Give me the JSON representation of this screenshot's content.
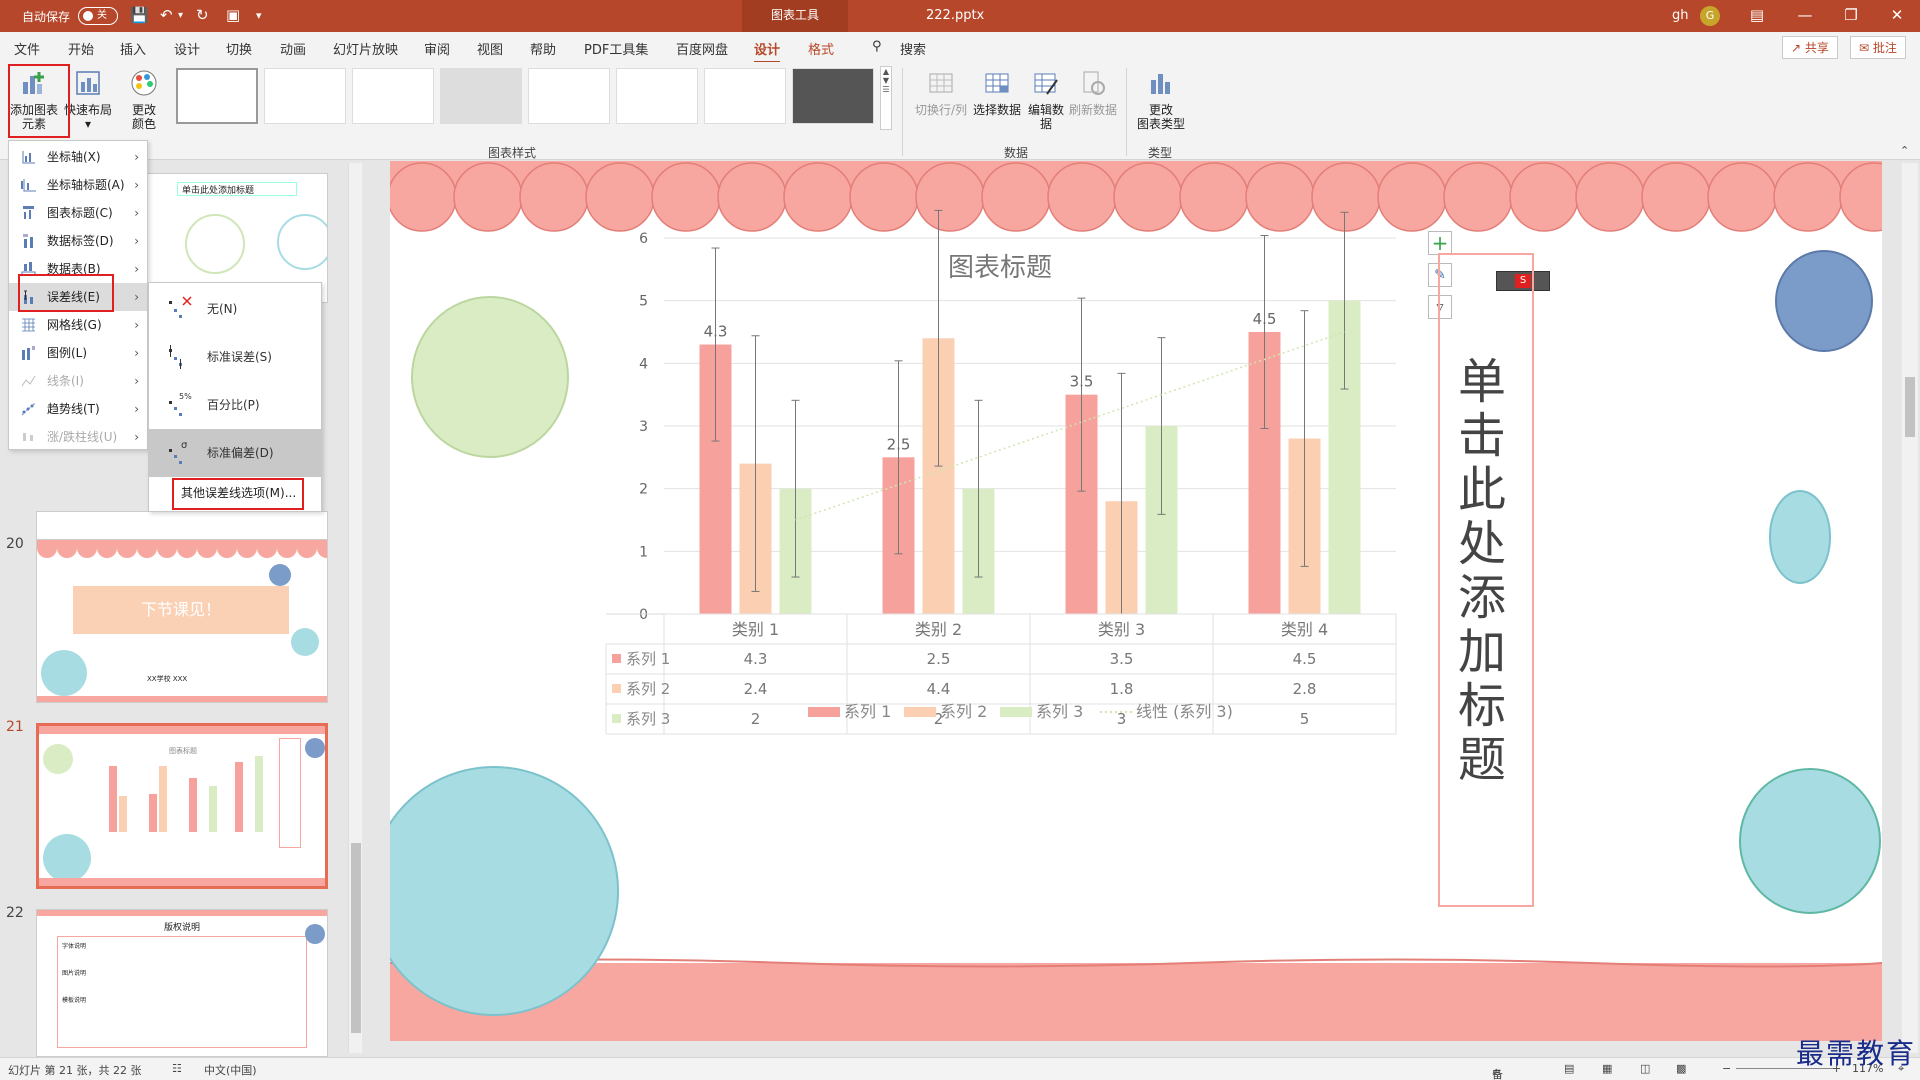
{
  "titlebar": {
    "autosave_label": "自动保存",
    "autosave_state": "关",
    "context_tab": "图表工具",
    "filename": "222.pptx",
    "user": "gh",
    "avatar_initial": "G"
  },
  "tabs": [
    {
      "label": "文件"
    },
    {
      "label": "开始"
    },
    {
      "label": "插入"
    },
    {
      "label": "设计"
    },
    {
      "label": "切换"
    },
    {
      "label": "动画"
    },
    {
      "label": "幻灯片放映"
    },
    {
      "label": "审阅"
    },
    {
      "label": "视图"
    },
    {
      "label": "帮助"
    },
    {
      "label": "PDF工具集"
    },
    {
      "label": "百度网盘"
    },
    {
      "label": "设计"
    },
    {
      "label": "格式"
    }
  ],
  "search_label": "搜索",
  "share_label": "共享",
  "comment_label": "批注",
  "ribbon": {
    "add_element_l1": "添加图表",
    "add_element_l2": "元素",
    "quick_layout": "快速布局",
    "change_color_l1": "更改",
    "change_color_l2": "颜色",
    "chart_styles_group": "图表样式",
    "switch_row_col": "切换行/列",
    "select_data": "选择数据",
    "edit_data_l1": "编辑数",
    "edit_data_l2": "据",
    "refresh_data": "刷新数据",
    "data_group": "数据",
    "change_type_l1": "更改",
    "change_type_l2": "图表类型",
    "type_group": "类型"
  },
  "menu": {
    "items": [
      {
        "label": "坐标轴(X)",
        "disabled": false
      },
      {
        "label": "坐标轴标题(A)",
        "disabled": false
      },
      {
        "label": "图表标题(C)",
        "disabled": false
      },
      {
        "label": "数据标签(D)",
        "disabled": false
      },
      {
        "label": "数据表(B)",
        "disabled": false
      },
      {
        "label": "误差线(E)",
        "disabled": false
      },
      {
        "label": "网格线(G)",
        "disabled": false
      },
      {
        "label": "图例(L)",
        "disabled": false
      },
      {
        "label": "线条(I)",
        "disabled": true
      },
      {
        "label": "趋势线(T)",
        "disabled": false
      },
      {
        "label": "涨/跌柱线(U)",
        "disabled": true
      }
    ]
  },
  "submenu": {
    "items": [
      {
        "label": "无(N)"
      },
      {
        "label": "标准误差(S)"
      },
      {
        "label": "百分比(P)"
      },
      {
        "label": "标准偏差(D)"
      }
    ],
    "more": "其他误差线选项(M)...",
    "pct_glyph": "5%",
    "sigma_glyph": "σ"
  },
  "slides": {
    "n20": "20",
    "n21": "21",
    "n22": "22",
    "s19_title": "单击此处添加标题",
    "s20_text": "下节课见！",
    "s20_sub": "XX学校  XXX",
    "s21_title": "图表标题",
    "s22_title": "版权说明",
    "s22_h1": "字体说明",
    "s22_h2": "图片说明",
    "s22_h3": "模板说明"
  },
  "slide_title": "单击此处添加标题",
  "chart_data": {
    "type": "bar",
    "title": "图表标题",
    "categories": [
      "类别 1",
      "类别 2",
      "类别 3",
      "类别 4"
    ],
    "series": [
      {
        "name": "系列 1",
        "values": [
          4.3,
          2.5,
          3.5,
          4.5
        ],
        "color": "#f7a19d"
      },
      {
        "name": "系列 2",
        "values": [
          2.4,
          4.4,
          1.8,
          2.8
        ],
        "color": "#fbcfb1"
      },
      {
        "name": "系列 3",
        "values": [
          2,
          2,
          3,
          5
        ],
        "color": "#d9ecc3"
      }
    ],
    "error_bar_sd": [
      1.54,
      2.04,
      1.41
    ],
    "trendline": {
      "name": "线性 (系列 3)",
      "series_index": 2
    },
    "data_labels_series": 0,
    "ylim": [
      0,
      6
    ],
    "yticks": [
      0,
      1,
      2,
      3,
      4,
      5,
      6
    ],
    "ylabel": "",
    "xlabel": "",
    "grid": true,
    "legend_position": "bottom",
    "data_table": true
  },
  "status": {
    "slide_info": "幻灯片 第 21 张，共 22 张",
    "language": "中文(中国)",
    "notes": "备注",
    "zoom": "117%"
  },
  "watermark": "最需教育",
  "colors": {
    "accent": "#b7472a",
    "highlight_box": "#e02020",
    "scallop": "#f7a7a0",
    "circle_blue": "#a8dce3",
    "circle_green": "#d9ecc3",
    "circle_navy": "#7b9bc9"
  }
}
